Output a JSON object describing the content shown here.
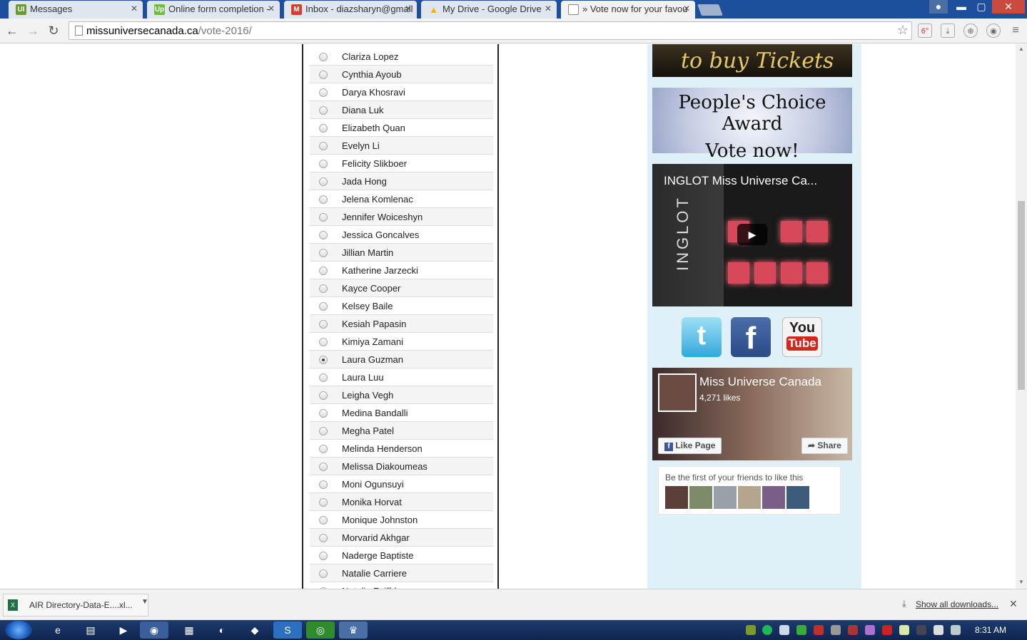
{
  "browser": {
    "tabs": [
      {
        "title": "Messages",
        "favicon": "UI",
        "color": "#6a9a2f"
      },
      {
        "title": "Online form completion - ",
        "favicon": "Up",
        "color": "#6fbb3f"
      },
      {
        "title": "Inbox - diazsharyn@gmail",
        "favicon": "M",
        "color": "#d23f31"
      },
      {
        "title": "My Drive - Google Drive",
        "favicon": "▲",
        "color": "#f4b400"
      },
      {
        "title": "» Vote now for your favou",
        "favicon": "",
        "color": "#ffffff"
      }
    ],
    "tab_close": "✕",
    "window_controls": {
      "minimize": "▬",
      "maximize": "▢",
      "close": "✕"
    },
    "url_domain": "missuniversecanada.ca",
    "url_path": "/vote-2016/",
    "extensions": [
      "6°",
      "⤓",
      "⊕",
      "◉",
      "≡"
    ]
  },
  "vote": {
    "candidates": [
      "Clariza Lopez",
      "Cynthia Ayoub",
      "Darya Khosravi",
      "Diana Luk",
      "Elizabeth Quan",
      "Evelyn Li",
      "Felicity Slikboer",
      "Jada Hong",
      "Jelena Komlenac",
      "Jennifer Woiceshyn",
      "Jessica Goncalves",
      "Jillian Martin",
      "Katherine Jarzecki",
      "Kayce Cooper",
      "Kelsey Baile",
      "Kesiah Papasin",
      "Kimiya Zamani",
      "Laura Guzman",
      "Laura Luu",
      "Leigha Vegh",
      "Medina Bandalli",
      "Megha Patel",
      "Melinda Henderson",
      "Melissa Diakoumeas",
      "Moni Ogunsuyi",
      "Monika Horvat",
      "Monique Johnston",
      "Morvarid Akhgar",
      "Naderge Baptiste",
      "Natalie Carriere",
      "Natalie Zeiffdeen"
    ],
    "selected": "Laura Guzman"
  },
  "sidebar": {
    "tickets_banner": "to buy Tickets",
    "peoples_choice_line1": "People's Choice Award",
    "peoples_choice_line2": "Vote now!",
    "video_title": "INGLOT Miss Universe Ca...",
    "video_brand": "INGLOT",
    "play_icon": "▶",
    "social": {
      "twitter": "t",
      "facebook": "f",
      "youtube_line1": "You",
      "youtube_line2": "Tube"
    },
    "fb_page_name": "Miss Universe Canada",
    "fb_likes": "4,271 likes",
    "fb_like_button": "Like Page",
    "fb_share_button": "Share",
    "fb_friends_text": "Be the first of your friends to like this"
  },
  "downloads": {
    "file_name": "AIR Directory-Data-E....xl...",
    "file_icon": "X",
    "show_all": "Show all downloads...",
    "close": "✕"
  },
  "taskbar": {
    "apps": [
      "e",
      "▤",
      "▶",
      "◉",
      "▦",
      "◐",
      "◆",
      "S",
      "◎",
      "♛"
    ],
    "clock": "8:31 AM"
  }
}
